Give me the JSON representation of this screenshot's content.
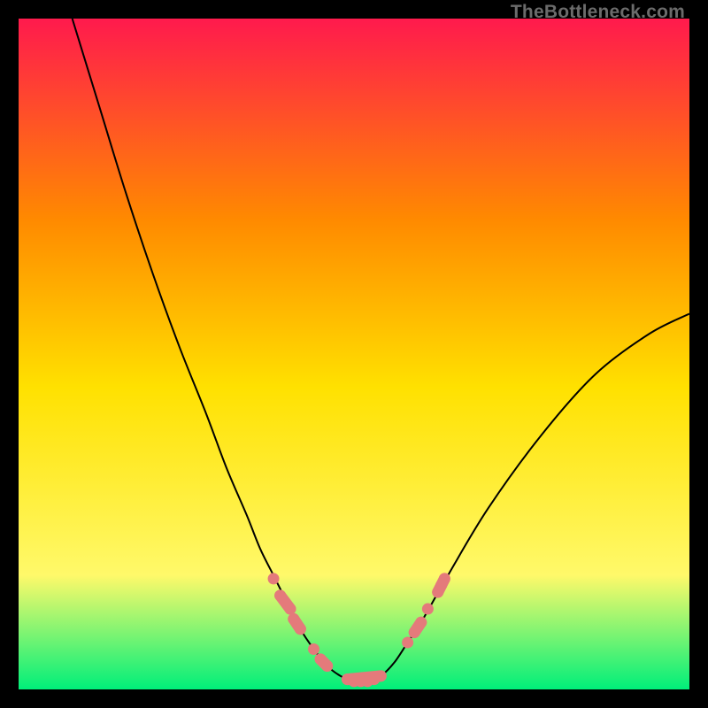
{
  "attribution": "TheBottleneck.com",
  "colors": {
    "bg_black": "#000000",
    "gradient_top": "#ff1a4d",
    "gradient_mid1": "#ff8a00",
    "gradient_mid2": "#ffe100",
    "gradient_mid3": "#fff96a",
    "gradient_bottom": "#00ef7a",
    "curve": "#000000",
    "markers": "#e47a7b"
  },
  "chart_data": {
    "type": "line",
    "title": "",
    "xlabel": "",
    "ylabel": "",
    "xlim": [
      0,
      100
    ],
    "ylim": [
      0,
      100
    ],
    "series": [
      {
        "name": "bottleneck-curve",
        "x": [
          8,
          12,
          16,
          20,
          24,
          28,
          31,
          34,
          36,
          38,
          40,
          42,
          44,
          46,
          48,
          50,
          52,
          54,
          56,
          58,
          60,
          64,
          70,
          78,
          86,
          94,
          100
        ],
        "y": [
          100,
          87,
          74,
          62,
          51,
          41,
          33,
          26,
          21,
          17,
          13,
          9,
          6,
          3.5,
          2,
          1.2,
          1.2,
          2,
          4,
          7,
          10,
          17,
          27,
          38,
          47,
          53,
          56
        ]
      }
    ],
    "markers": [
      {
        "x": 38,
        "y": 16.5
      },
      {
        "x": 39,
        "y": 14
      },
      {
        "x": 40.5,
        "y": 12
      },
      {
        "x": 41,
        "y": 10.5
      },
      {
        "x": 42,
        "y": 9
      },
      {
        "x": 44,
        "y": 6
      },
      {
        "x": 45,
        "y": 4.5
      },
      {
        "x": 46,
        "y": 3.5
      },
      {
        "x": 49,
        "y": 1.5
      },
      {
        "x": 50,
        "y": 1.2
      },
      {
        "x": 51,
        "y": 1.2
      },
      {
        "x": 52,
        "y": 1.2
      },
      {
        "x": 53,
        "y": 1.5
      },
      {
        "x": 54,
        "y": 2
      },
      {
        "x": 58,
        "y": 7
      },
      {
        "x": 59,
        "y": 8.5
      },
      {
        "x": 60,
        "y": 10
      },
      {
        "x": 61,
        "y": 12
      },
      {
        "x": 62.5,
        "y": 14.5
      },
      {
        "x": 63,
        "y": 15.5
      },
      {
        "x": 63.5,
        "y": 16.5
      }
    ],
    "marker_pairs": [
      {
        "from": 1,
        "to": 2
      },
      {
        "from": 3,
        "to": 4
      },
      {
        "from": 6,
        "to": 7
      },
      {
        "from": 8,
        "to": 13
      },
      {
        "from": 15,
        "to": 16
      },
      {
        "from": 18,
        "to": 20
      }
    ]
  }
}
